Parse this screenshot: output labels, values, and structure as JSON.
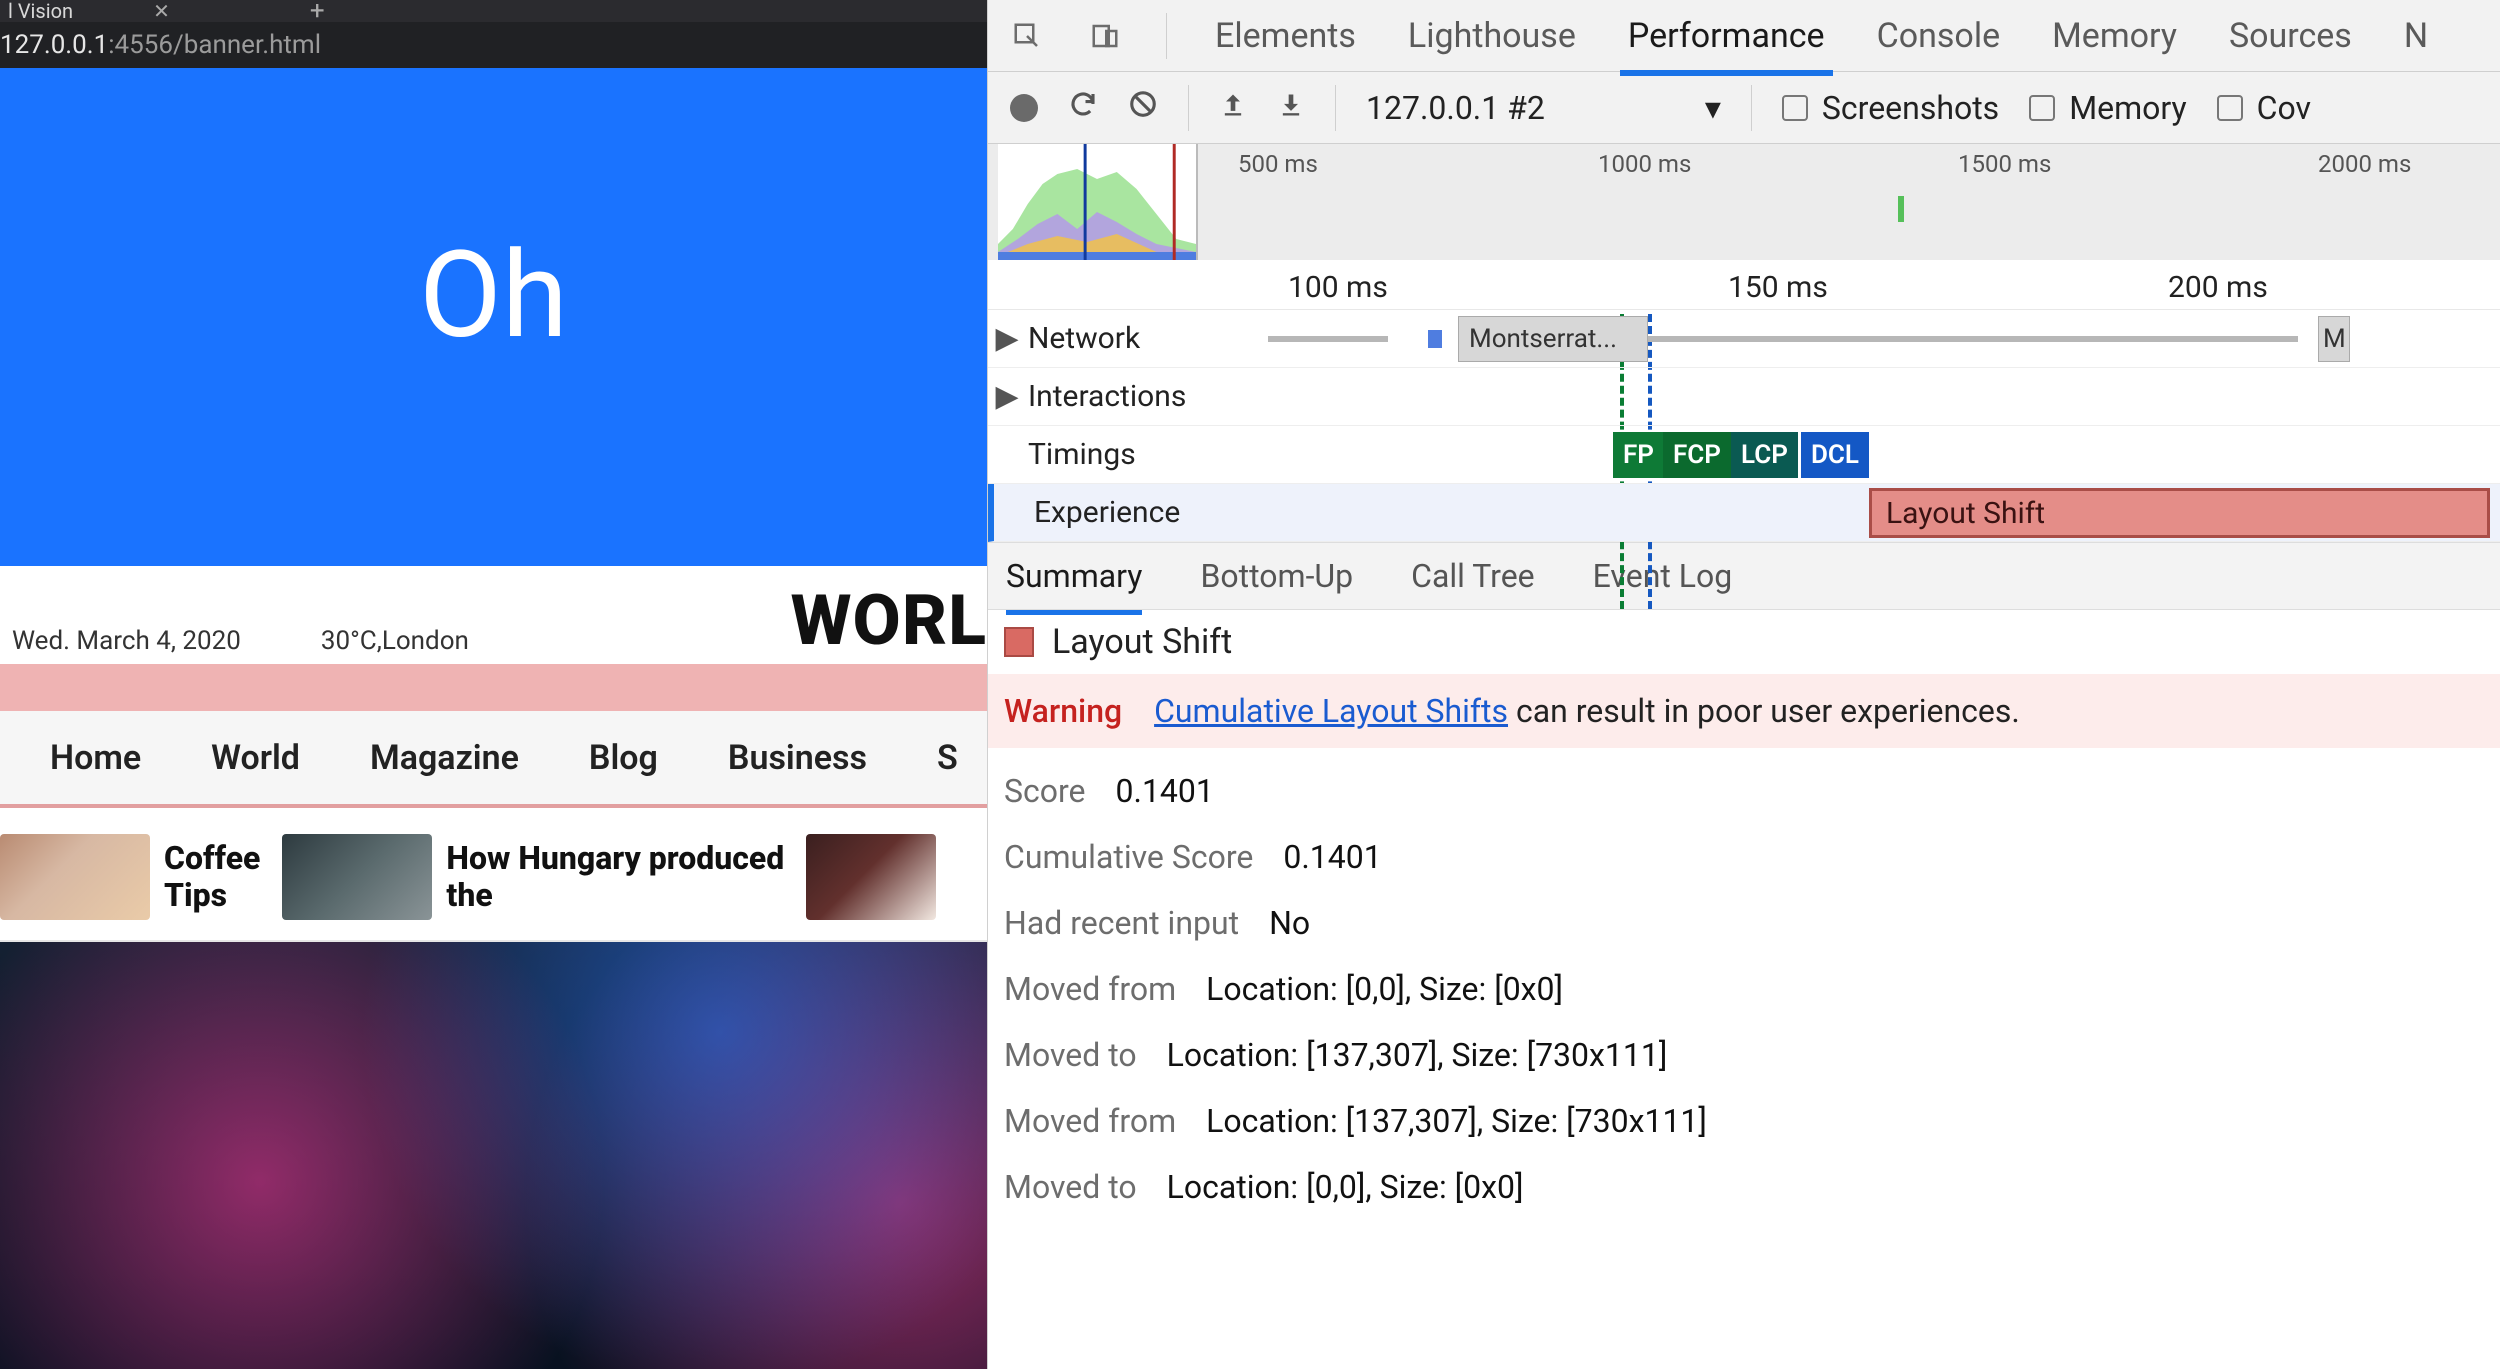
{
  "browser": {
    "tab_title": "l Vision",
    "url_host": "127.0.0.1",
    "url_rest": ":4556/banner.html"
  },
  "page": {
    "banner_text": "Oh",
    "date": "Wed. March 4, 2020",
    "weather": "30°C,London",
    "headline_partial": "WORL",
    "nav": [
      "Home",
      "World",
      "Magazine",
      "Blog",
      "Business",
      "S"
    ],
    "cards": [
      {
        "title_l1": "Coffee",
        "title_l2": "Tips"
      },
      {
        "title_l1": "How Hungary produced",
        "title_l2": "the"
      }
    ]
  },
  "devtools": {
    "top_icons": [
      "inspect",
      "device"
    ],
    "tabs": [
      "Elements",
      "Lighthouse",
      "Performance",
      "Console",
      "Memory",
      "Sources",
      "N"
    ],
    "active_tab": "Performance",
    "toolbar": {
      "profile_label": "127.0.0.1 #2",
      "checkboxes": [
        "Screenshots",
        "Memory",
        "Cov"
      ]
    },
    "overview_ticks": [
      "500 ms",
      "1000 ms",
      "1500 ms",
      "2000 ms"
    ],
    "ruler_ticks": [
      "100 ms",
      "150 ms",
      "200 ms"
    ],
    "tracks": {
      "network": "Network",
      "network_item": "Montserrat...",
      "network_item_short": "M",
      "interactions": "Interactions",
      "timings": "Timings",
      "timing_markers": [
        "FP",
        "FCP",
        "LCP",
        "DCL"
      ],
      "experience": "Experience",
      "experience_item": "Layout Shift"
    },
    "subtabs": [
      "Summary",
      "Bottom-Up",
      "Call Tree",
      "Event Log"
    ],
    "active_subtab": "Summary",
    "summary": {
      "title": "Layout Shift",
      "warning_label": "Warning",
      "warning_link": "Cumulative Layout Shifts",
      "warning_rest": " can result in poor user experiences.",
      "rows": [
        {
          "k": "Score",
          "v": "0.1401"
        },
        {
          "k": "Cumulative Score",
          "v": "0.1401"
        },
        {
          "k": "Had recent input",
          "v": "No"
        },
        {
          "k": "Moved from",
          "v": "Location: [0,0], Size: [0x0]"
        },
        {
          "k": "Moved to",
          "v": "Location: [137,307], Size: [730x111]"
        },
        {
          "k": "Moved from",
          "v": "Location: [137,307], Size: [730x111]"
        },
        {
          "k": "Moved to",
          "v": "Location: [0,0], Size: [0x0]"
        }
      ]
    }
  }
}
